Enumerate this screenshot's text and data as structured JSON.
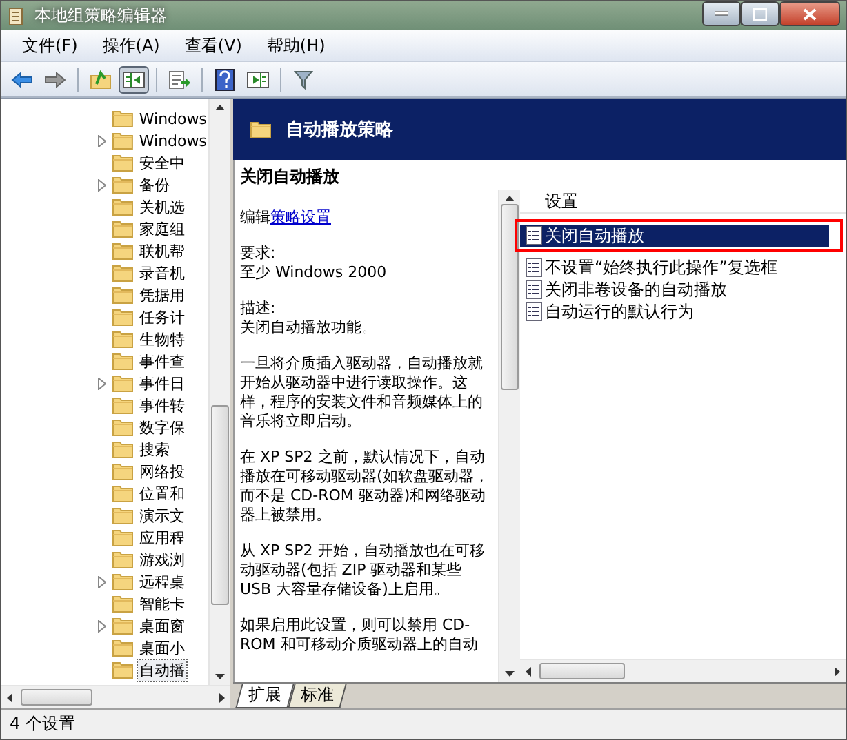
{
  "window": {
    "title": "本地组策略编辑器"
  },
  "menu": [
    {
      "label": "文件(F)"
    },
    {
      "label": "操作(A)"
    },
    {
      "label": "查看(V)"
    },
    {
      "label": "帮助(H)"
    }
  ],
  "toolbar": {
    "show_tree_pressed": true
  },
  "tree": {
    "items": [
      {
        "label": "Windows",
        "expandable": false,
        "selected": false
      },
      {
        "label": "Windows",
        "expandable": true,
        "selected": false
      },
      {
        "label": "安全中",
        "expandable": false,
        "selected": false
      },
      {
        "label": "备份",
        "expandable": true,
        "selected": false
      },
      {
        "label": "关机选",
        "expandable": false,
        "selected": false
      },
      {
        "label": "家庭组",
        "expandable": false,
        "selected": false
      },
      {
        "label": "联机帮",
        "expandable": false,
        "selected": false
      },
      {
        "label": "录音机",
        "expandable": false,
        "selected": false
      },
      {
        "label": "凭据用",
        "expandable": false,
        "selected": false
      },
      {
        "label": "任务计",
        "expandable": false,
        "selected": false
      },
      {
        "label": "生物特",
        "expandable": false,
        "selected": false
      },
      {
        "label": "事件查",
        "expandable": false,
        "selected": false
      },
      {
        "label": "事件日",
        "expandable": true,
        "selected": false
      },
      {
        "label": "事件转",
        "expandable": false,
        "selected": false
      },
      {
        "label": "数字保",
        "expandable": false,
        "selected": false
      },
      {
        "label": "搜索",
        "expandable": false,
        "selected": false
      },
      {
        "label": "网络投",
        "expandable": false,
        "selected": false
      },
      {
        "label": "位置和",
        "expandable": false,
        "selected": false
      },
      {
        "label": "演示文",
        "expandable": false,
        "selected": false
      },
      {
        "label": "应用程",
        "expandable": false,
        "selected": false
      },
      {
        "label": "游戏浏",
        "expandable": false,
        "selected": false
      },
      {
        "label": "远程桌",
        "expandable": true,
        "selected": false
      },
      {
        "label": "智能卡",
        "expandable": false,
        "selected": false
      },
      {
        "label": "桌面窗",
        "expandable": true,
        "selected": false
      },
      {
        "label": "桌面小",
        "expandable": false,
        "selected": false
      },
      {
        "label": "自动播",
        "expandable": false,
        "selected": true
      }
    ]
  },
  "header": {
    "title": "自动播放策略"
  },
  "details": {
    "heading": "关闭自动播放",
    "edit_prefix": "编辑",
    "edit_link": "策略设置",
    "blocks": [
      {
        "lines": [
          "要求:",
          "至少 Windows 2000"
        ]
      },
      {
        "lines": [
          "描述:",
          "关闭自动播放功能。"
        ]
      },
      {
        "lines": [
          "一旦将介质插入驱动器，自动播放就开始从驱动器中进行读取操作。这样，程序的安装文件和音频媒体上的音乐将立即启动。"
        ]
      },
      {
        "lines": [
          "在 XP SP2 之前，默认情况下，自动播放在可移动驱动器(如软盘驱动器，而不是 CD-ROM 驱动器)和网络驱动器上被禁用。"
        ]
      },
      {
        "lines": [
          "从 XP SP2 开始，自动播放也在可移动驱动器(包括 ZIP 驱动器和某些 USB 大容量存储设备)上启用。"
        ]
      },
      {
        "lines": [
          "如果启用此设置，则可以禁用 CD-ROM 和可移动介质驱动器上的自动"
        ]
      }
    ]
  },
  "settings": {
    "column": "设置",
    "items": [
      {
        "label": "关闭自动播放",
        "selected": true,
        "highlighted": true
      },
      {
        "label": "不设置“始终执行此操作”复选框",
        "selected": false,
        "highlighted": false
      },
      {
        "label": "关闭非卷设备的自动播放",
        "selected": false,
        "highlighted": false
      },
      {
        "label": "自动运行的默认行为",
        "selected": false,
        "highlighted": false
      }
    ]
  },
  "tabs": [
    {
      "label": "扩展",
      "selected": true
    },
    {
      "label": "标准",
      "selected": false
    }
  ],
  "status_bar": {
    "text": "4 个设置"
  }
}
